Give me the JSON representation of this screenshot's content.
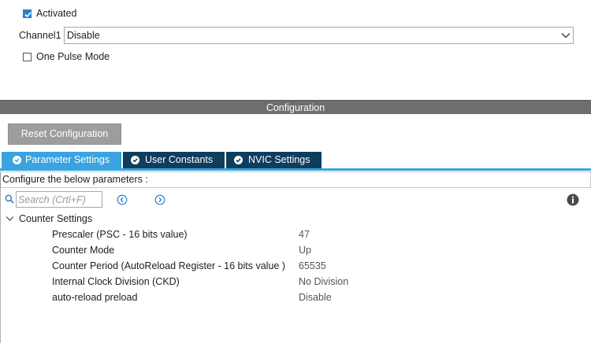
{
  "mode": {
    "activated_label": "Activated",
    "activated_checked": true,
    "channel1_label": "Channel1",
    "channel1_value": "Disable",
    "one_pulse_label": "One Pulse Mode",
    "one_pulse_checked": false
  },
  "configuration": {
    "title": "Configuration",
    "reset_label": "Reset Configuration",
    "tabs": [
      {
        "label": "Parameter Settings",
        "active": true
      },
      {
        "label": "User Constants",
        "active": false
      },
      {
        "label": "NVIC Settings",
        "active": false
      }
    ],
    "description": "Configure the below parameters :",
    "search_placeholder": "Search (Crtl+F)",
    "group": {
      "title": "Counter Settings",
      "params": [
        {
          "name": "Prescaler (PSC - 16 bits value)",
          "value": "47"
        },
        {
          "name": "Counter Mode",
          "value": "Up"
        },
        {
          "name": "Counter Period (AutoReload Register - 16 bits value )",
          "value": "65535"
        },
        {
          "name": "Internal Clock Division (CKD)",
          "value": "No Division"
        },
        {
          "name": "auto-reload preload",
          "value": "Disable"
        }
      ]
    }
  },
  "colors": {
    "tab_active": "#3aa3e0",
    "tab_inactive": "#0e3d5e",
    "config_bar": "#6e6e6e",
    "reset_button": "#9d9d9d",
    "checkbox_accent": "#2b7fd1"
  },
  "icons": [
    "check-icon",
    "chevron-down-icon",
    "check-circle-icon",
    "search-icon",
    "arrow-left-circle-icon",
    "arrow-right-circle-icon",
    "info-icon",
    "collapse-chevron-icon"
  ]
}
